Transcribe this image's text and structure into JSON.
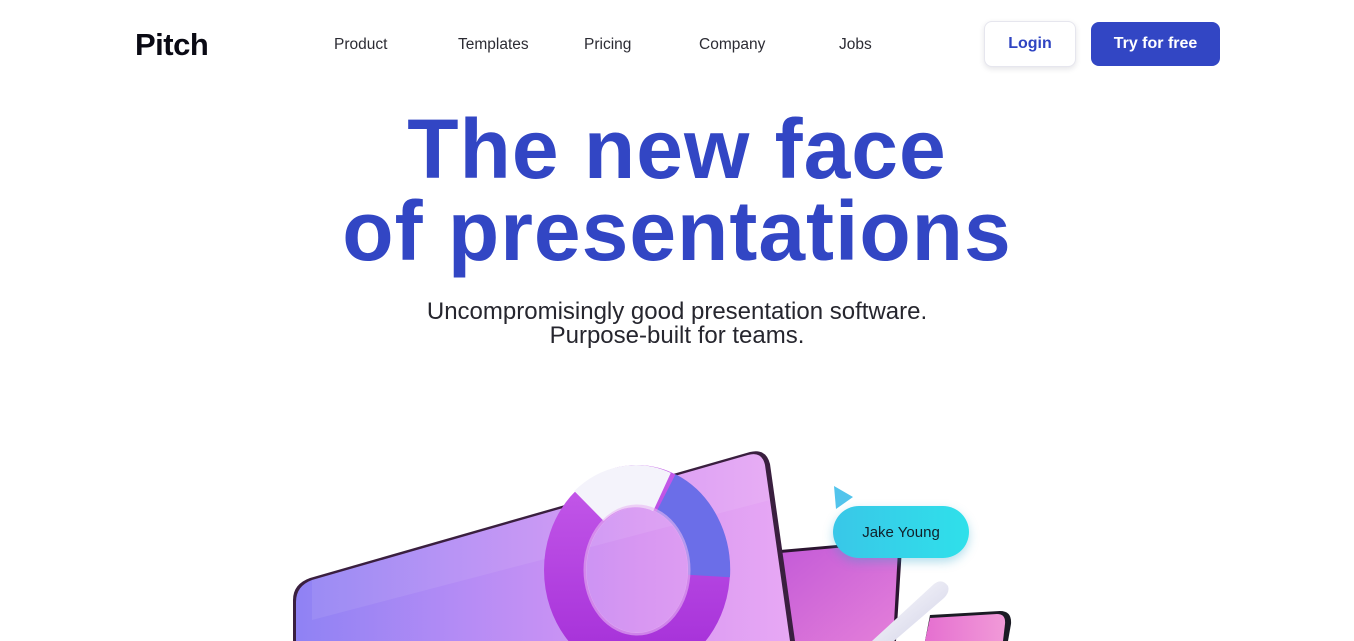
{
  "nav": {
    "logo": "Pitch",
    "items": [
      {
        "label": "Product"
      },
      {
        "label": "Templates"
      },
      {
        "label": "Pricing"
      },
      {
        "label": "Company"
      },
      {
        "label": "Jobs"
      }
    ],
    "login_label": "Login",
    "try_label": "Try for free"
  },
  "hero": {
    "title_line1": "The new face",
    "title_line2": "of presentations",
    "subtitle_line1": "Uncompromisingly good presentation software.",
    "subtitle_line2": "Purpose-built for teams."
  },
  "illustration": {
    "cursor_name": "Jake Young"
  },
  "colors": {
    "brand": "#3246c4",
    "text": "#26262e",
    "cursor_bubble": "#39c7e8"
  }
}
